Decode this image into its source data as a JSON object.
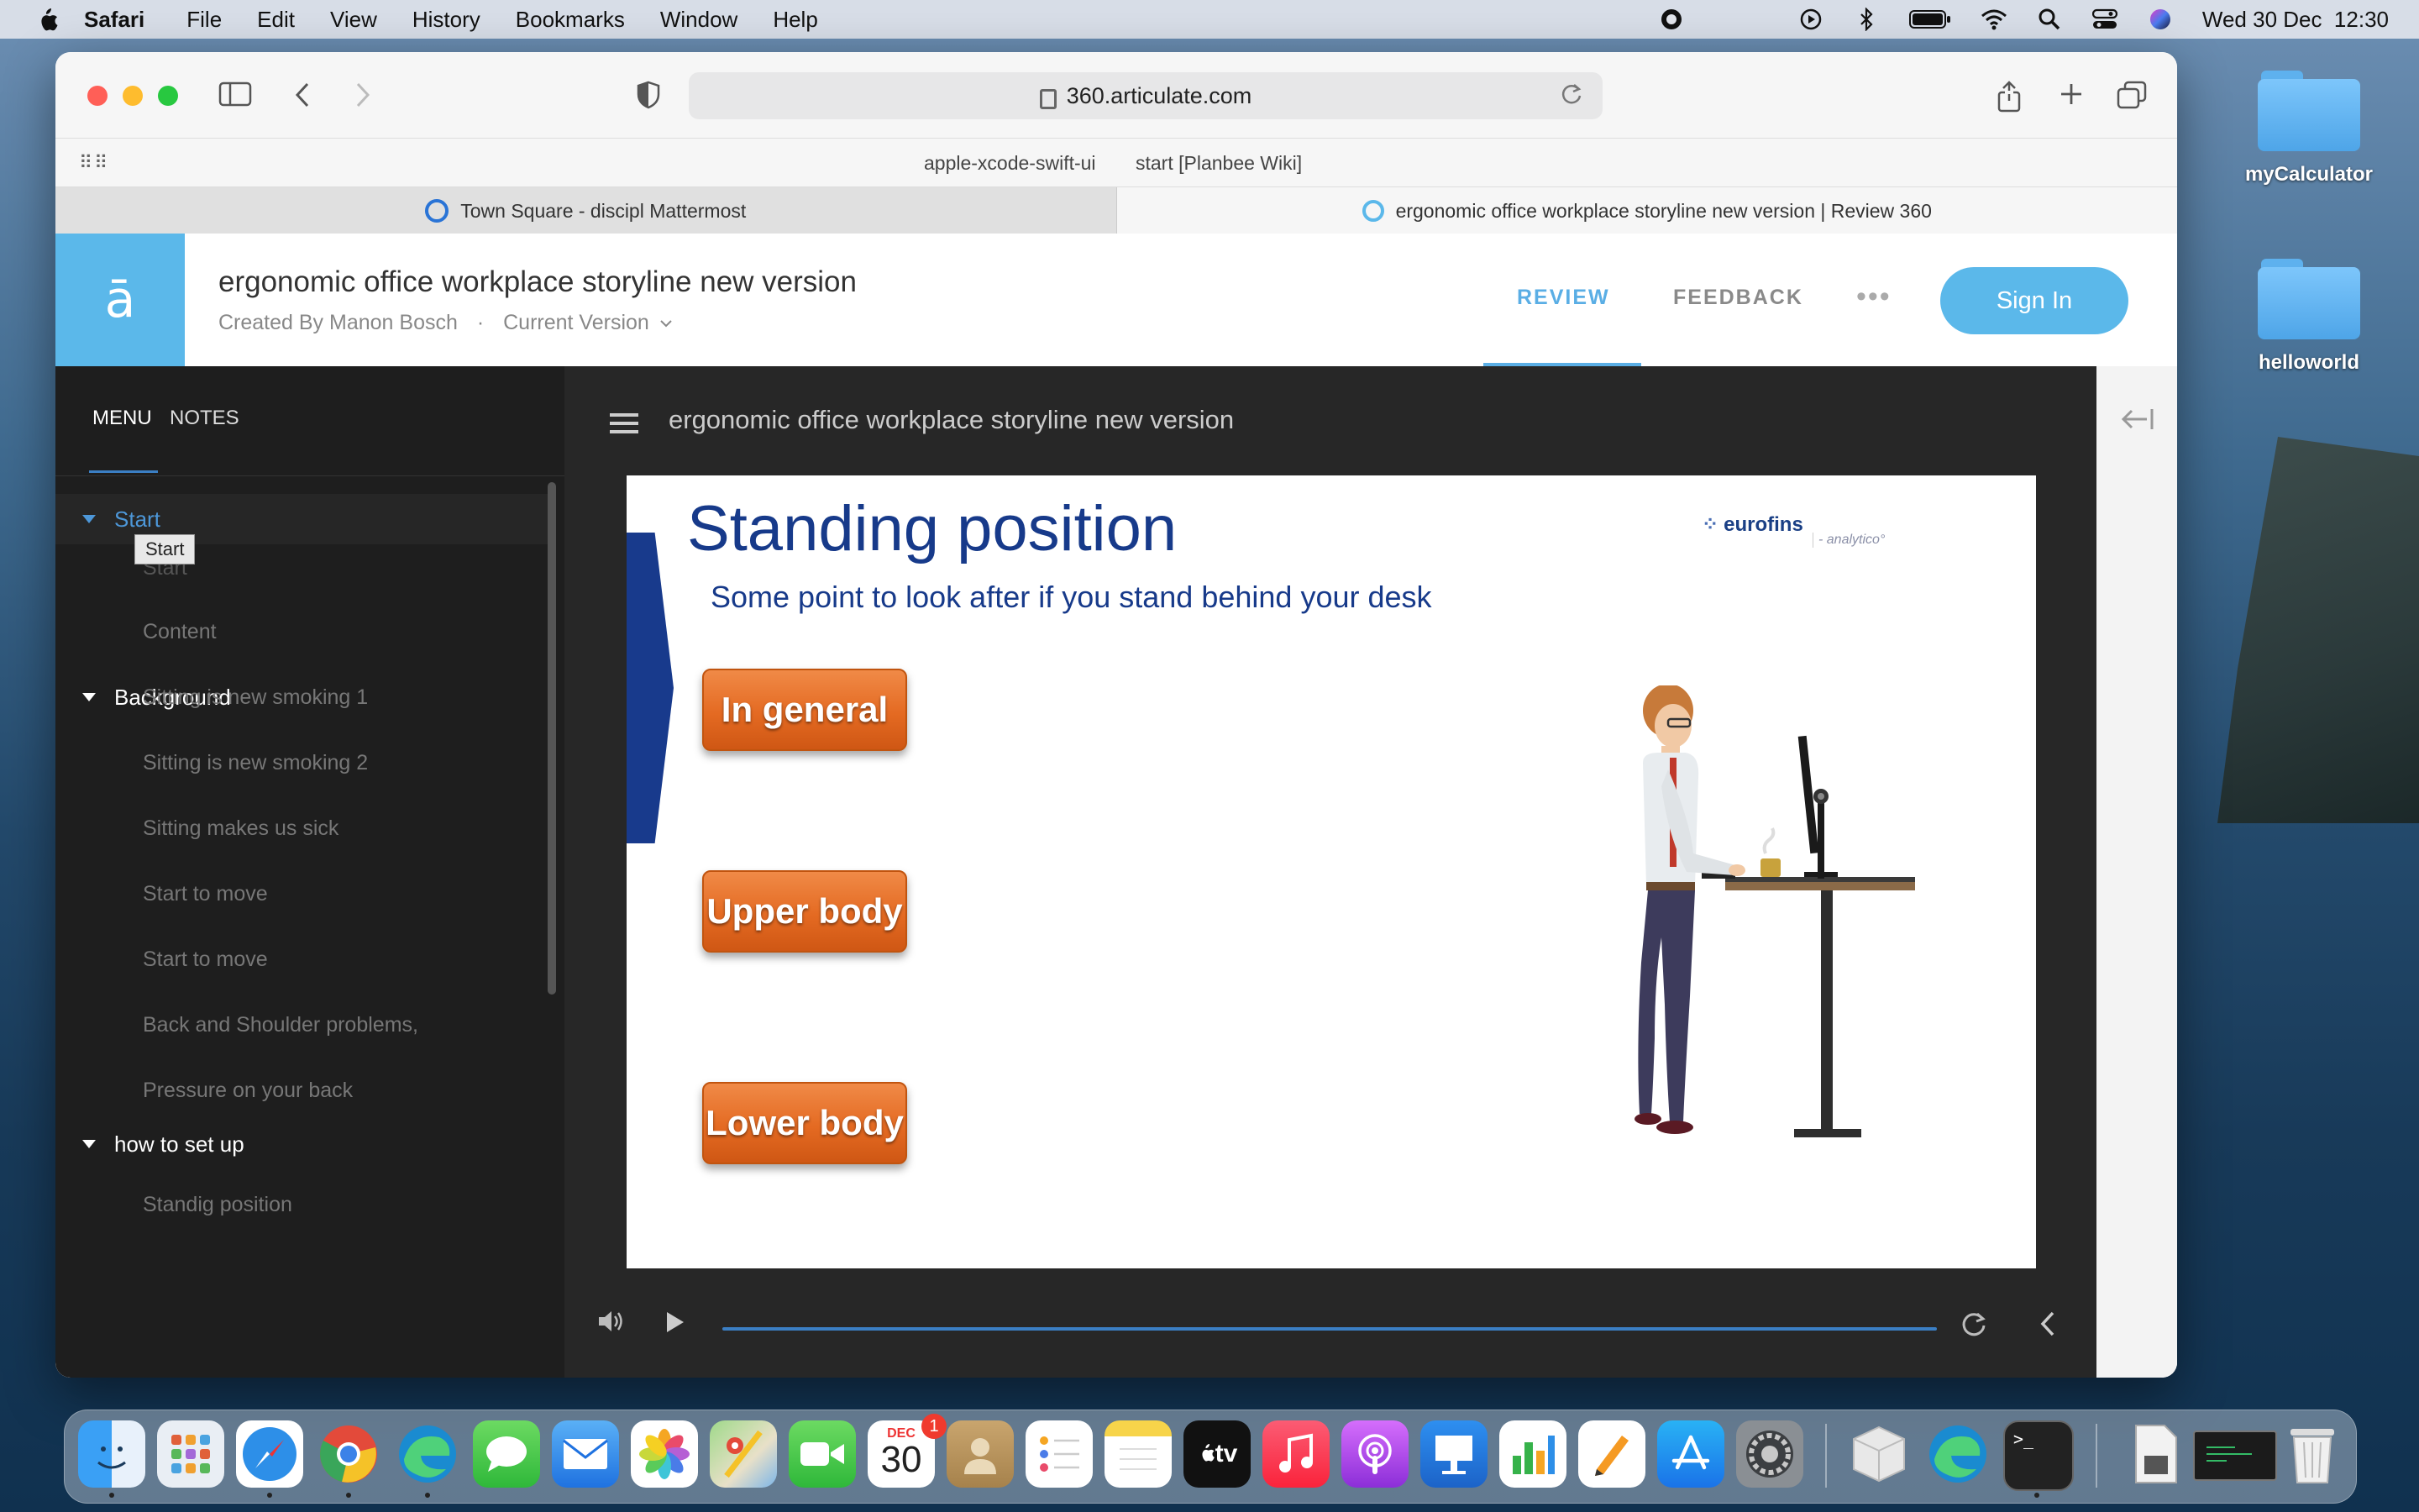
{
  "menubar": {
    "app": "Safari",
    "items": [
      "File",
      "Edit",
      "View",
      "History",
      "Bookmarks",
      "Window",
      "Help"
    ],
    "clock": "Wed 30 Dec  12:30"
  },
  "desktop": {
    "folders": [
      {
        "label": "myCalculator"
      },
      {
        "label": "helloworld"
      }
    ]
  },
  "browser": {
    "url": "360.articulate.com",
    "favorites": [
      "apple-xcode-swift-ui",
      "start [Planbee Wiki]"
    ],
    "tabs": [
      {
        "title": "Town Square - discipl Mattermost",
        "active": false
      },
      {
        "title": "ergonomic office workplace storyline new version | Review 360",
        "active": true
      }
    ]
  },
  "review": {
    "logo": "ā",
    "title": "ergonomic office workplace storyline new version",
    "created_by": "Created By Manon Bosch",
    "separator": "·",
    "version": "Current Version",
    "nav_review": "REVIEW",
    "nav_feedback": "FEEDBACK",
    "more": "•••",
    "sign_in": "Sign In",
    "accent": "#5bb8ea"
  },
  "sidebar": {
    "tab_menu": "MENU",
    "tab_notes": "NOTES",
    "tooltip": "Start",
    "sections": [
      {
        "label": "Start",
        "items": [
          "Start",
          "Content"
        ]
      },
      {
        "label": "Background",
        "items": [
          "Sitting is new smoking 1",
          "Sitting is new smoking 2",
          "Sitting makes us sick",
          "Start to move",
          "Start to move",
          "Back and Shoulder problems,",
          "Pressure on your back"
        ]
      },
      {
        "label": "how to set up",
        "items": [
          "Standig position"
        ]
      }
    ]
  },
  "player": {
    "title": "ergonomic office workplace storyline new version",
    "progress": 1.0
  },
  "slide": {
    "title": "Standing position",
    "subtitle": "Some point to look after if you stand behind your desk",
    "logo": "eurofins",
    "logo_sub": "analytico",
    "buttons": [
      "In general",
      "Upper body",
      "Lower body"
    ],
    "button_color": "#e46a22",
    "title_color": "#173a8a"
  },
  "dock": {
    "calendar_month": "DEC",
    "calendar_day": "30",
    "calendar_badge": "1",
    "tv_label": "tv"
  }
}
